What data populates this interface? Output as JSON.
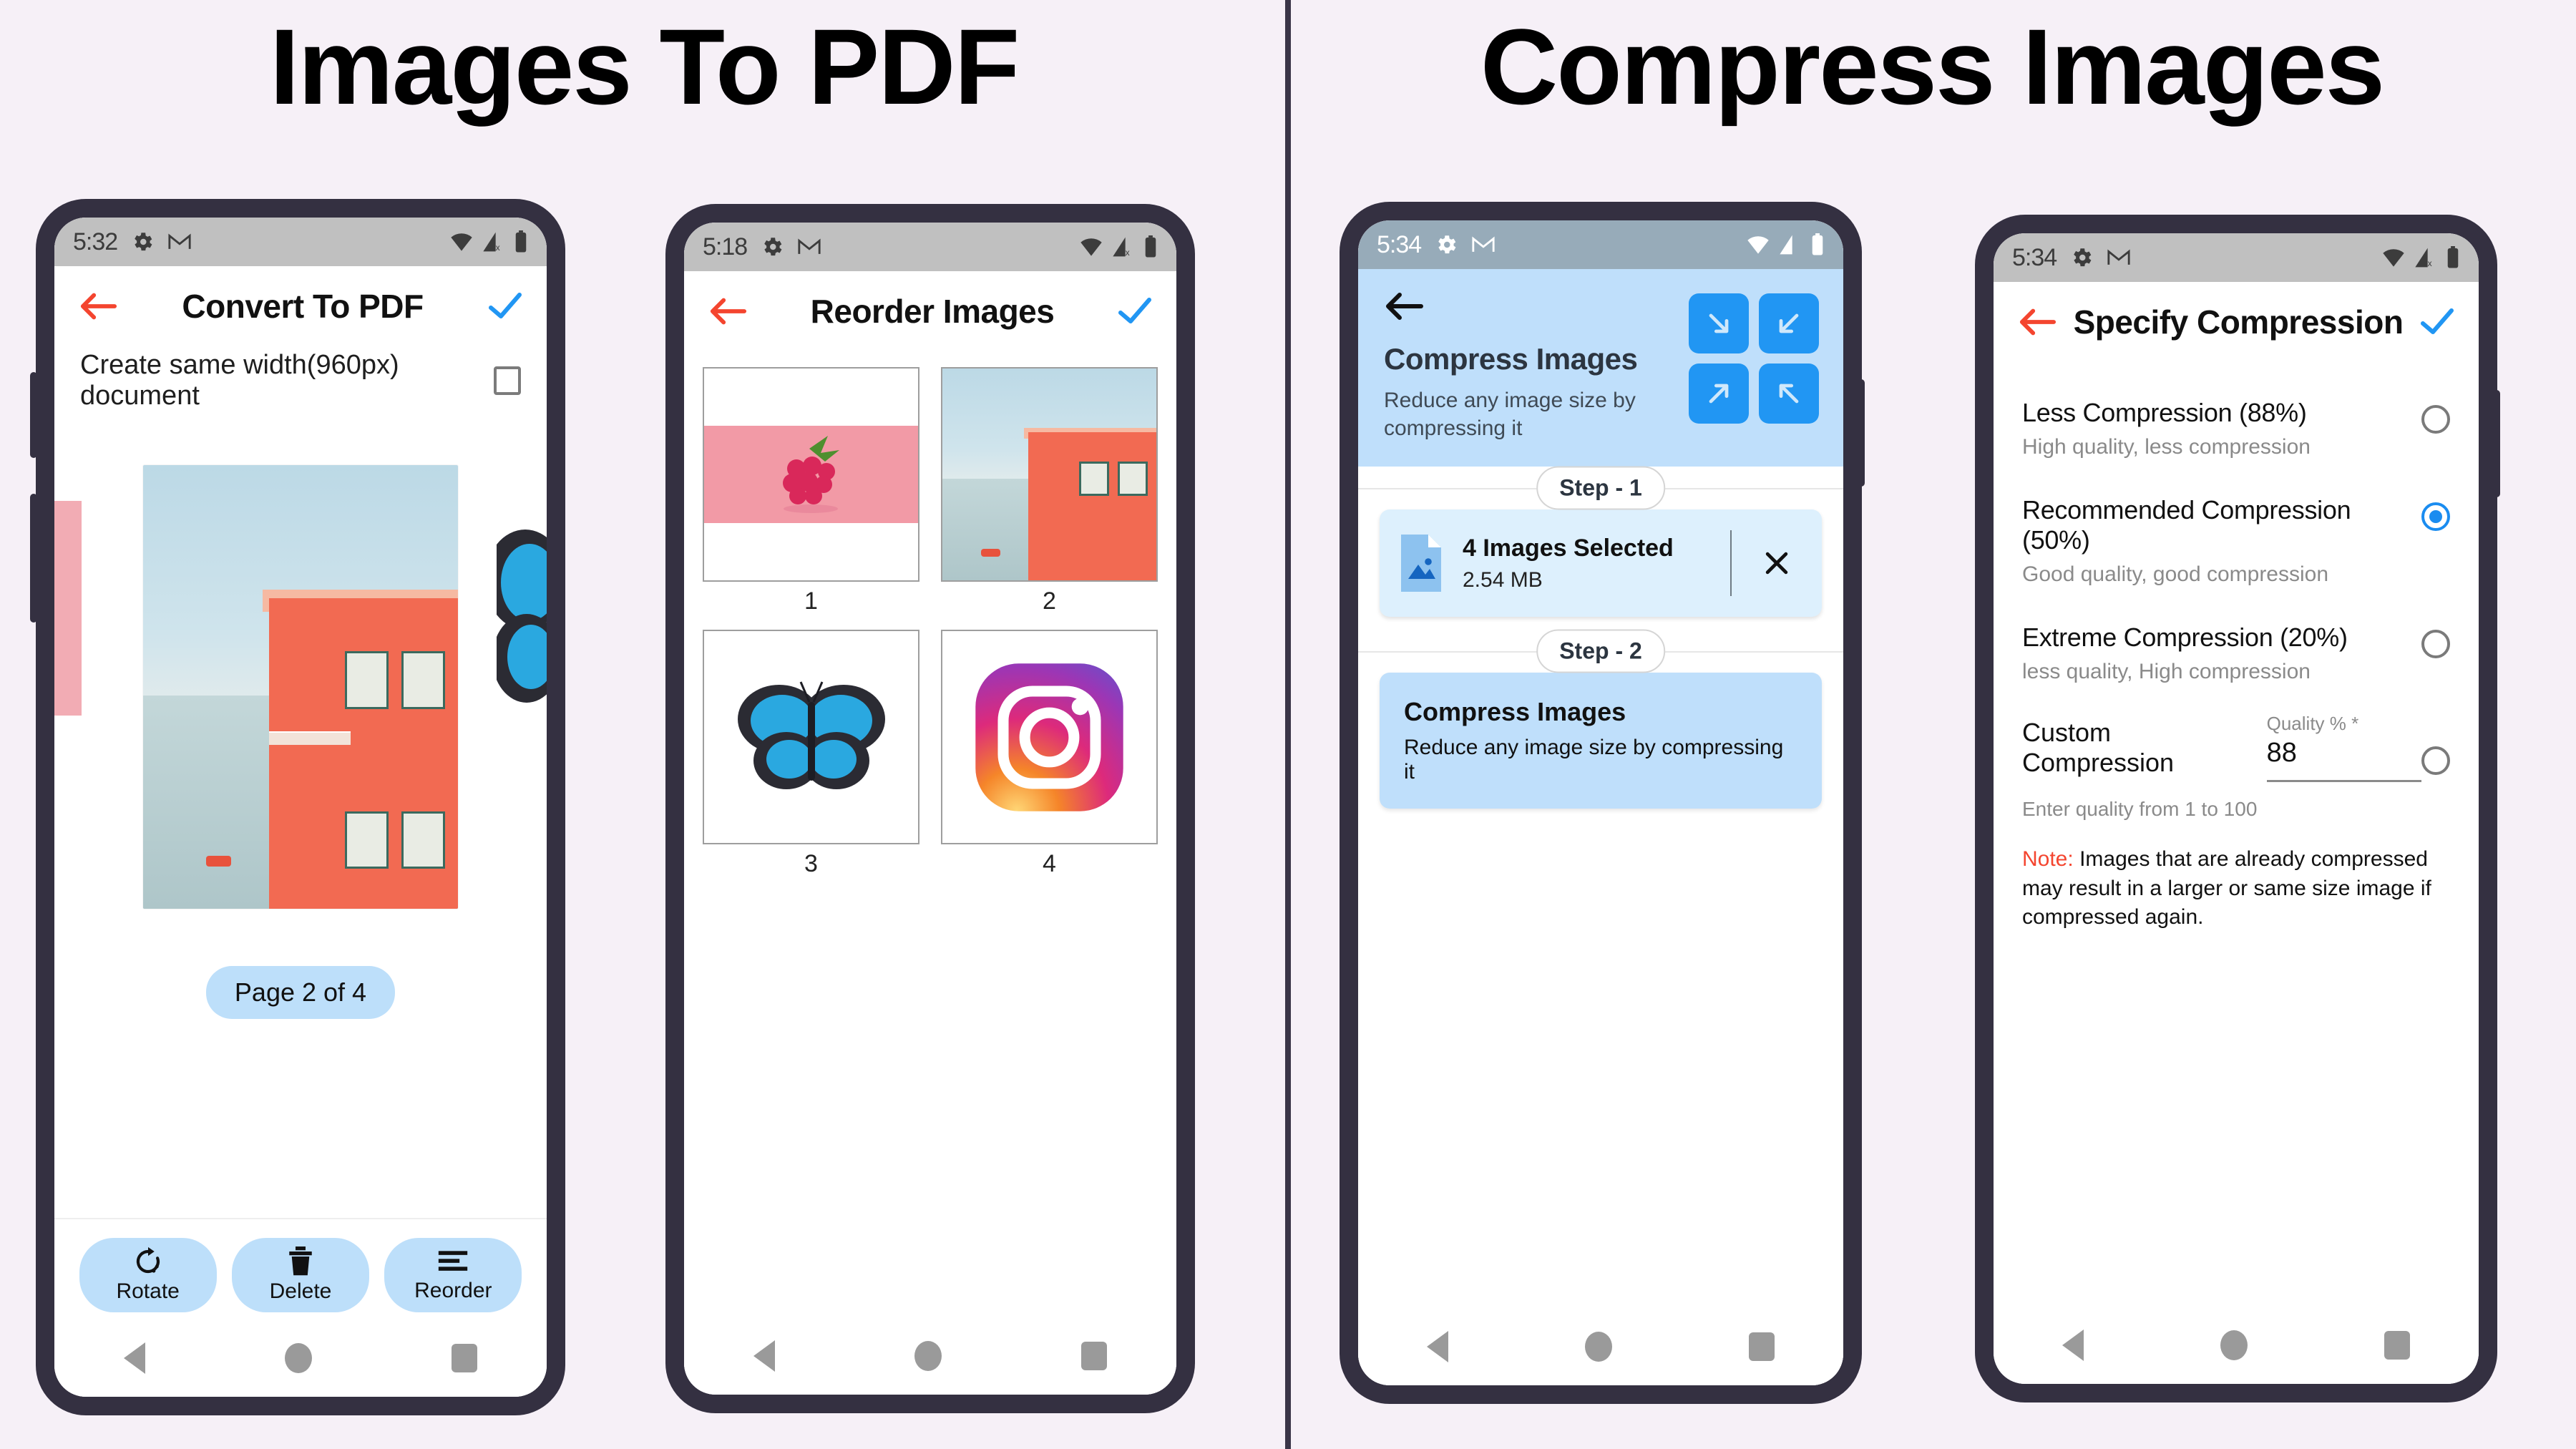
{
  "panels": {
    "left_title": "Images To PDF",
    "right_title": "Compress Images"
  },
  "phone1": {
    "status": {
      "time": "5:32",
      "icons": [
        "gear-icon",
        "gmail-icon",
        "wifi-icon",
        "signal-off-icon",
        "battery-icon"
      ]
    },
    "appbar": {
      "back": "back-arrow",
      "title": "Convert To PDF",
      "confirm": "check-icon"
    },
    "option_label": "Create same width(960px) document",
    "option_checked": false,
    "page_indicator": "Page 2 of 4",
    "tools": [
      {
        "icon": "rotate-icon",
        "label": "Rotate"
      },
      {
        "icon": "trash-icon",
        "label": "Delete"
      },
      {
        "icon": "reorder-icon",
        "label": "Reorder"
      }
    ],
    "nav": [
      "back",
      "home",
      "recents"
    ]
  },
  "phone2": {
    "status": {
      "time": "5:18"
    },
    "appbar": {
      "title": "Reorder Images"
    },
    "thumbs": [
      {
        "num": "1",
        "kind": "raspberry"
      },
      {
        "num": "2",
        "kind": "building"
      },
      {
        "num": "3",
        "kind": "butterfly"
      },
      {
        "num": "4",
        "kind": "instagram"
      }
    ]
  },
  "phone3": {
    "status": {
      "time": "5:34"
    },
    "header": {
      "title": "Compress Images",
      "subtitle": "Reduce any image size by compressing it",
      "arrows": [
        "arrow-down-right-icon",
        "arrow-down-left-icon",
        "arrow-up-right-icon",
        "arrow-up-left-icon"
      ]
    },
    "step1_label": "Step - 1",
    "step2_label": "Step - 2",
    "file_card": {
      "title": "4 Images Selected",
      "size": "2.54 MB",
      "remove": "close-icon"
    },
    "action_card": {
      "title": "Compress Images",
      "subtitle": "Reduce any image size by compressing it"
    }
  },
  "phone4": {
    "status": {
      "time": "5:34"
    },
    "appbar": {
      "title": "Specify Compression"
    },
    "options": [
      {
        "title": "Less Compression (88%)",
        "sub": "High quality, less compression",
        "selected": false
      },
      {
        "title": "Recommended Compression (50%)",
        "sub": "Good quality, good compression",
        "selected": true
      },
      {
        "title": "Extreme Compression (20%)",
        "sub": "less quality, High compression",
        "selected": false
      }
    ],
    "custom": {
      "label": "Custom Compression",
      "field_caption": "Quality % *",
      "field_value": "88",
      "selected": false,
      "helper": "Enter quality from 1 to 100"
    },
    "note": {
      "label": "Note:",
      "text": "Images that are already compressed may result in a larger or same size image if compressed again."
    }
  },
  "colors": {
    "background": "#f6f0f7",
    "frame": "#343041",
    "accent_blue": "#2196f3",
    "chip_blue": "#bddffa",
    "check_blue": "#1a8cf0",
    "back_red": "#f4452f",
    "note_red": "#f4452f"
  }
}
